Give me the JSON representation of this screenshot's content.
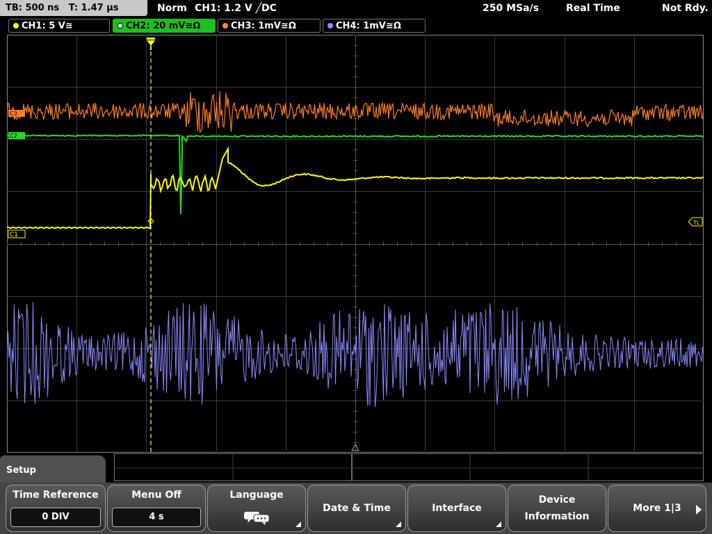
{
  "status": {
    "timebase": "TB: 500 ns",
    "trigger_time": "T: 1.47 µs",
    "mode": "Norm",
    "trigger": "CH1: 1.2 V ╱DC",
    "sample_rate": "250 MSa/s",
    "acq_mode": "Real Time",
    "state": "Not Rdy."
  },
  "channels": [
    {
      "id": "ch1",
      "label": "CH1: 5 V≅",
      "color": "#ffff00",
      "active": false
    },
    {
      "id": "ch2",
      "label": "CH2: 20 mV≅Ω",
      "color": "#22dd22",
      "active": true
    },
    {
      "id": "ch3",
      "label": "CH3: 1mV≅Ω",
      "color": "#ff8a2a",
      "active": false
    },
    {
      "id": "ch4",
      "label": "CH4: 1mV≅Ω",
      "color": "#9090ff",
      "active": false
    }
  ],
  "markers": {
    "c1": "C1",
    "c2": "C2",
    "c3": "C3",
    "tl": "TL"
  },
  "menu": {
    "title": "Setup",
    "time_reference_label": "Time Reference",
    "time_reference_value": "0 DIV",
    "menu_off_label": "Menu Off",
    "menu_off_value": "4 s",
    "language_label": "Language",
    "date_time_label": "Date & Time",
    "interface_label": "Interface",
    "device_info_label_1": "Device",
    "device_info_label_2": "Information",
    "more_label": "More 1|3"
  },
  "icons": {
    "language": "speech-bubbles-icon",
    "more": "arrow-right-icon",
    "submenu": "corner-triangle-icon"
  }
}
